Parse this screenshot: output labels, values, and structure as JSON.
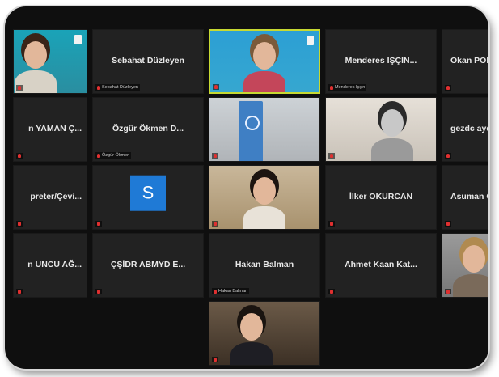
{
  "participants": [
    {
      "display": "",
      "label": "",
      "video": "v-teal",
      "kind": "video-woman"
    },
    {
      "display": "Sebahat Düzleyen",
      "label": "Sebahat Düzleyen",
      "video": "",
      "kind": "name"
    },
    {
      "display": "",
      "label": "",
      "video": "v-blue",
      "kind": "video-woman-active"
    },
    {
      "display": "Menderes IŞÇIN...",
      "label": "Menderes Işçin",
      "video": "",
      "kind": "name"
    },
    {
      "display": "Okan POL",
      "label": "",
      "video": "",
      "kind": "name"
    },
    {
      "display": "n YAMAN Ç...",
      "label": "",
      "video": "",
      "kind": "name"
    },
    {
      "display": "Özgür Ökmen D...",
      "label": "Özgür Ökmen",
      "video": "",
      "kind": "name"
    },
    {
      "display": "",
      "label": "",
      "video": "v-room",
      "kind": "video-flag"
    },
    {
      "display": "",
      "label": "",
      "video": "v-light",
      "kind": "video-woman-bw"
    },
    {
      "display": "gezdc ayd",
      "label": "",
      "video": "",
      "kind": "name"
    },
    {
      "display": "preter/Çevi...",
      "label": "",
      "video": "",
      "kind": "name"
    },
    {
      "display": "",
      "label": "",
      "video": "",
      "kind": "avatar",
      "avatar_letter": "S"
    },
    {
      "display": "",
      "label": "",
      "video": "v-beige",
      "kind": "video-woman-dark"
    },
    {
      "display": "İlker OKURCAN",
      "label": "",
      "video": "",
      "kind": "name"
    },
    {
      "display": "Asuman G",
      "label": "",
      "video": "",
      "kind": "name"
    },
    {
      "display": "n UNCU AĞ...",
      "label": "",
      "video": "",
      "kind": "name"
    },
    {
      "display": "ÇŞİDR ABMYD E...",
      "label": "",
      "video": "",
      "kind": "name"
    },
    {
      "display": "Hakan Balman",
      "label": "Hakan Balman",
      "video": "",
      "kind": "name"
    },
    {
      "display": "Ahmet Kaan Kat...",
      "label": "",
      "video": "",
      "kind": "name"
    },
    {
      "display": "",
      "label": "",
      "video": "v-gray",
      "kind": "video-woman-smile"
    },
    {
      "display": "",
      "label": "",
      "video": "",
      "kind": "empty"
    },
    {
      "display": "",
      "label": "",
      "video": "",
      "kind": "empty"
    },
    {
      "display": "",
      "label": "",
      "video": "v-warm",
      "kind": "video-man"
    },
    {
      "display": "",
      "label": "",
      "video": "",
      "kind": "empty"
    },
    {
      "display": "",
      "label": "",
      "video": "",
      "kind": "empty"
    }
  ],
  "colors": {
    "background": "#0f0f0f",
    "tile": "#222222",
    "active_border": "#c7d932",
    "mic_muted": "#e03030",
    "avatar": "#1f7ad6"
  }
}
